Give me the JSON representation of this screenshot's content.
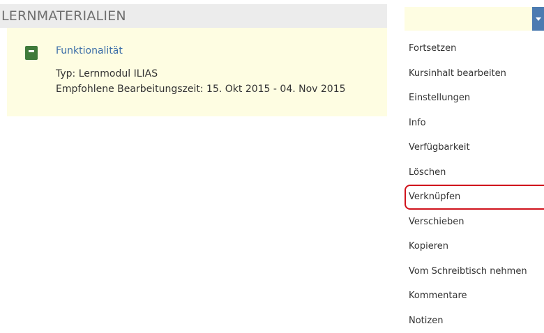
{
  "section": {
    "title": "LERNMATERIALIEN"
  },
  "item": {
    "title": "Funktionalität",
    "type": "Typ: Lernmodul ILIAS",
    "time": "Empfohlene Bearbeitungszeit: 15. Okt 2015 - 04. Nov 2015",
    "icon": "learning-module-icon"
  },
  "menu": {
    "items": [
      {
        "label": "Fortsetzen"
      },
      {
        "label": "Kursinhalt bearbeiten"
      },
      {
        "label": "Einstellungen"
      },
      {
        "label": "Info"
      },
      {
        "label": "Verfügbarkeit"
      },
      {
        "label": "Löschen"
      },
      {
        "label": "Verknüpfen",
        "highlighted": true
      },
      {
        "label": "Verschieben"
      },
      {
        "label": "Kopieren"
      },
      {
        "label": "Vom Schreibtisch nehmen"
      },
      {
        "label": "Kommentare"
      },
      {
        "label": "Notizen"
      }
    ]
  },
  "colors": {
    "highlight_border": "#d0131c",
    "link": "#3c6ea8",
    "panel_background": "#fefde2",
    "header_background": "#ececec",
    "icon_green": "#3f7a3a",
    "dropdown_button": "#4c7bb1"
  }
}
